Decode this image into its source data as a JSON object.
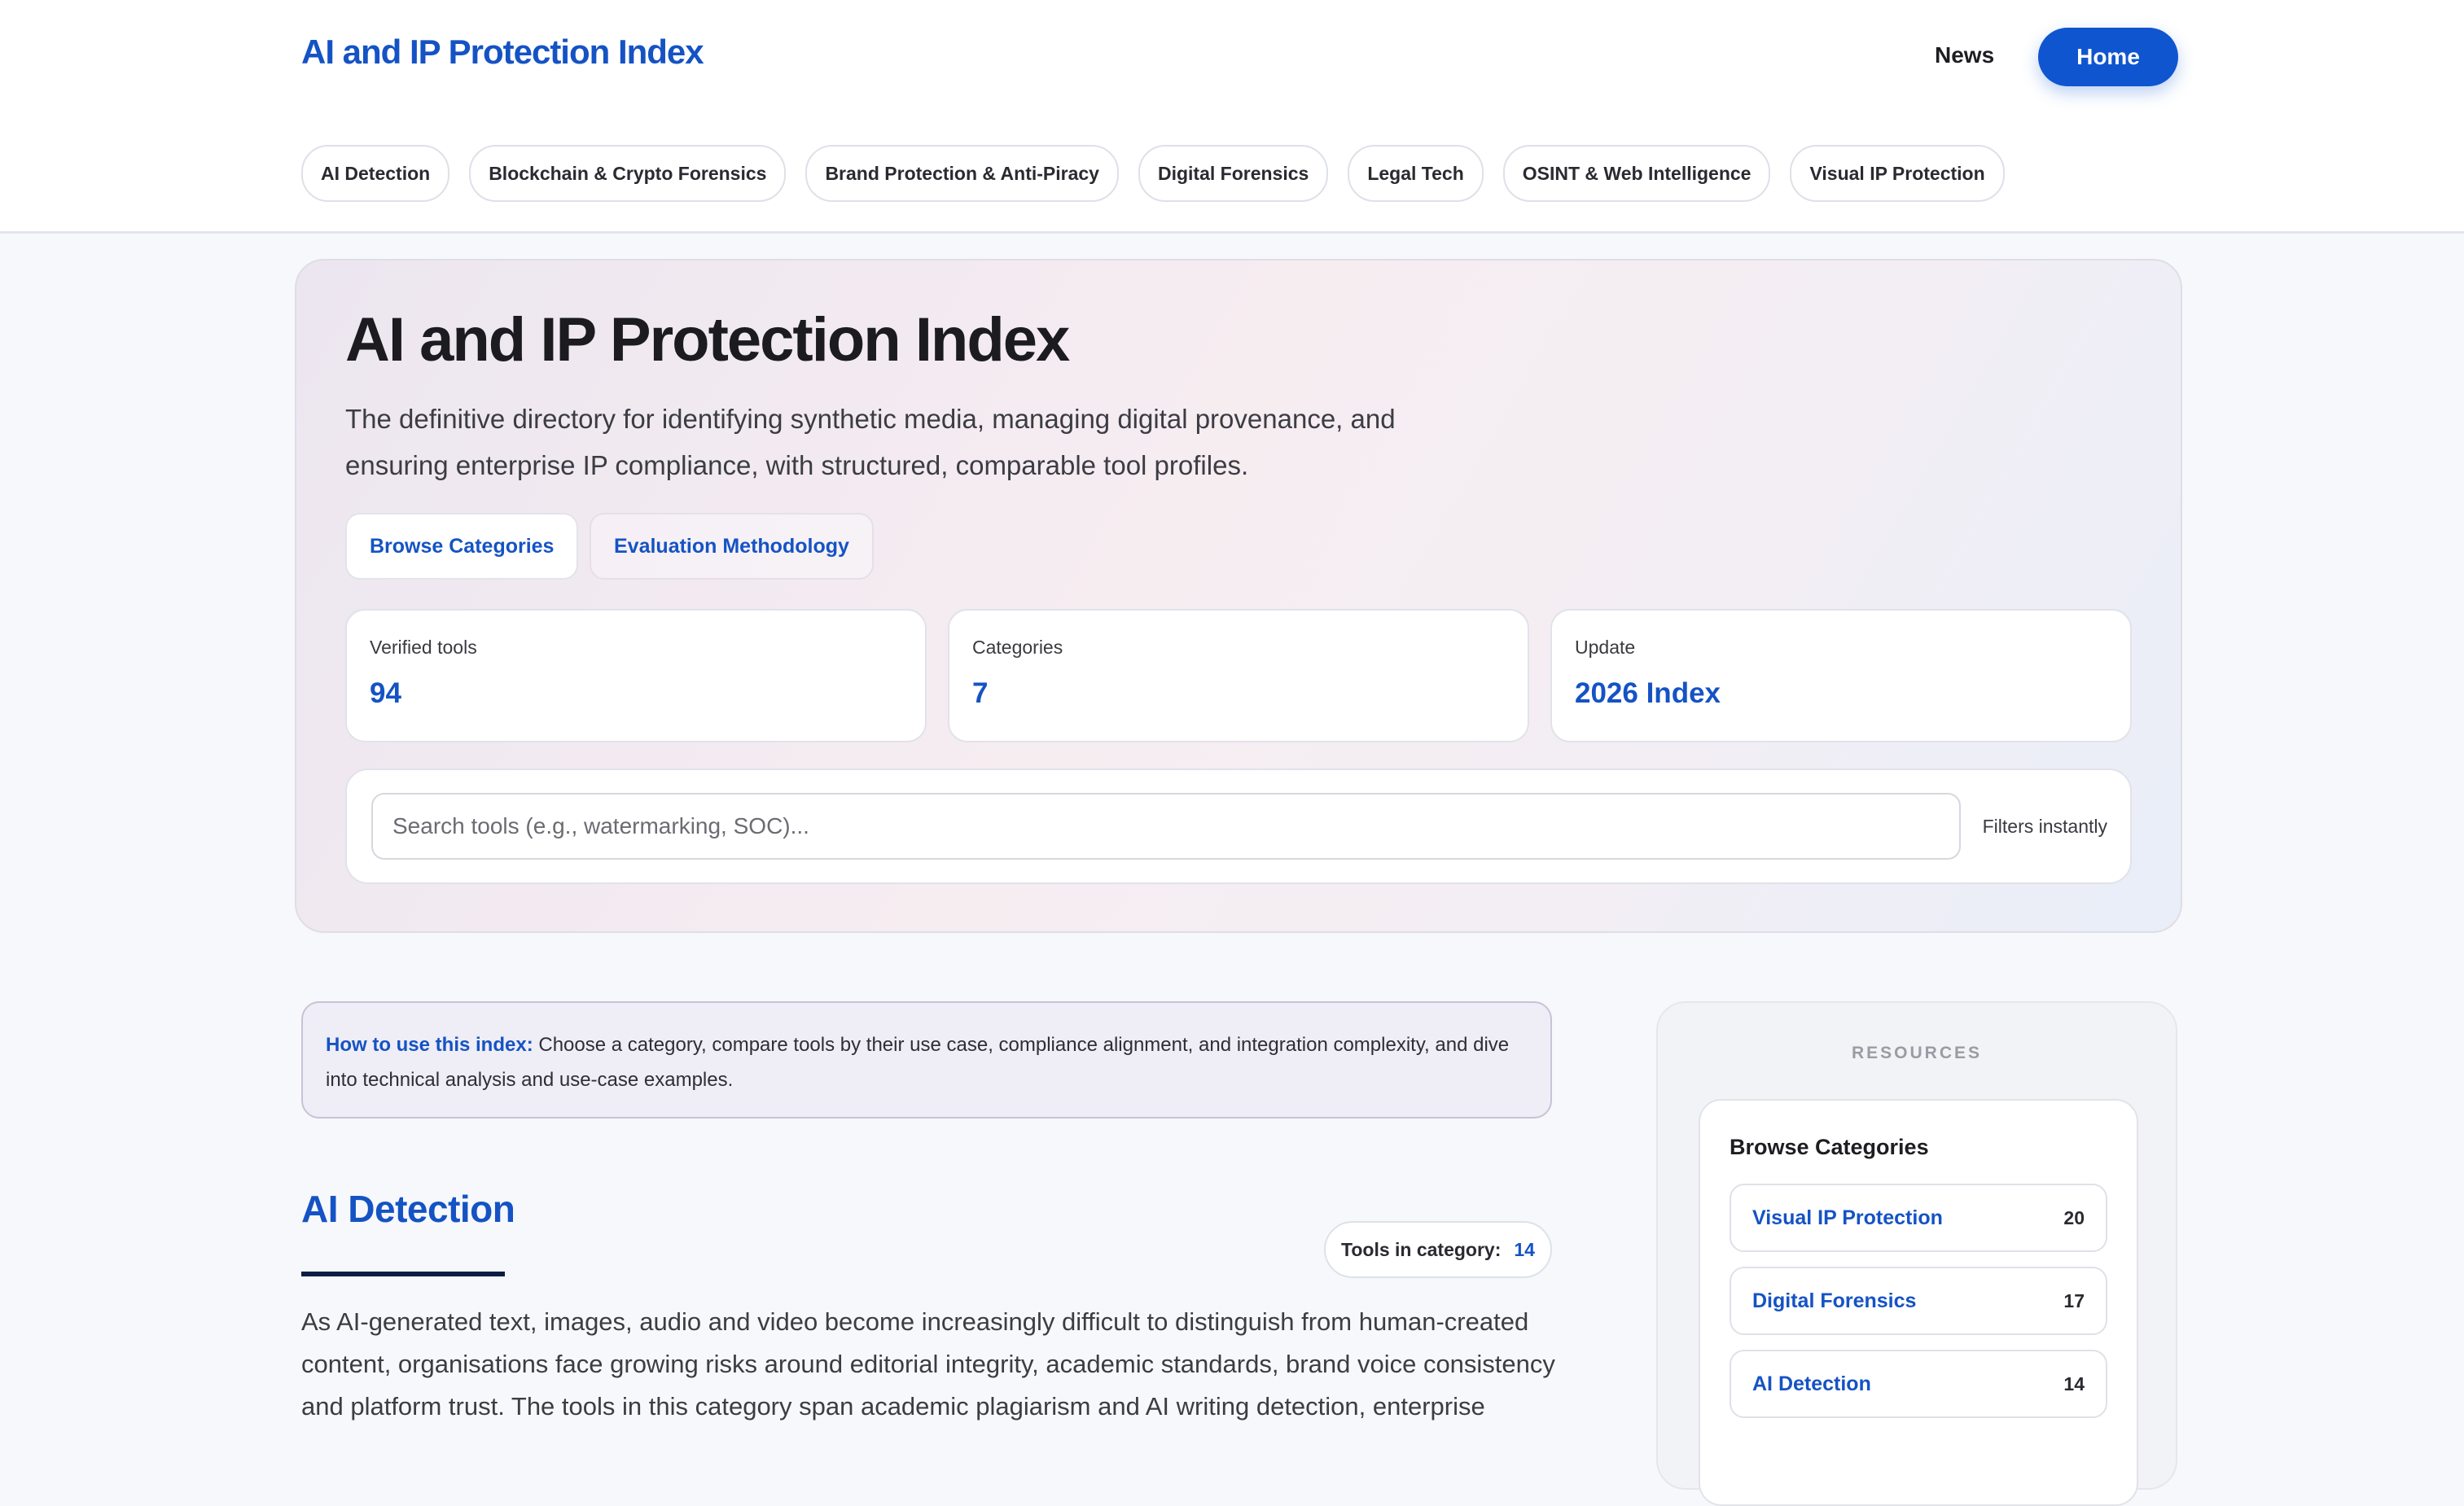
{
  "header": {
    "brand": "AI and IP Protection Index",
    "nav_news": "News",
    "nav_home": "Home",
    "category_chips": [
      "AI Detection",
      "Blockchain & Crypto Forensics",
      "Brand Protection & Anti-Piracy",
      "Digital Forensics",
      "Legal Tech",
      "OSINT & Web Intelligence",
      "Visual IP Protection"
    ]
  },
  "hero": {
    "title": "AI and IP Protection Index",
    "description": "The definitive directory for identifying synthetic media, managing digital provenance, and ensuring enterprise IP compliance, with structured, comparable tool profiles.",
    "browse_label": "Browse Categories",
    "methodology_label": "Evaluation Methodology",
    "stats": [
      {
        "label": "Verified tools",
        "value": "94"
      },
      {
        "label": "Categories",
        "value": "7"
      },
      {
        "label": "Update",
        "value": "2026 Index"
      }
    ],
    "search": {
      "placeholder": "Search tools (e.g., watermarking, SOC)...",
      "hint": "Filters instantly"
    }
  },
  "info": {
    "lead": "How to use this index:",
    "text": " Choose a category, compare tools by their use case, compliance alignment, and integration complexity, and dive into technical analysis and use-case examples."
  },
  "section": {
    "title": "AI Detection",
    "tools_label": "Tools in category:",
    "tools_count": "14",
    "body": "As AI-generated text, images, audio and video become increasingly difficult to distinguish from human-created content, organisations face growing risks around editorial integrity, academic standards, brand voice consistency and platform trust. The tools in this category span academic plagiarism and AI writing detection, enterprise"
  },
  "sidebar": {
    "heading": "RESOURCES",
    "card_title": "Browse Categories",
    "categories": [
      {
        "name": "Visual IP Protection",
        "count": "20"
      },
      {
        "name": "Digital Forensics",
        "count": "17"
      },
      {
        "name": "AI Detection",
        "count": "14"
      }
    ]
  },
  "colors": {
    "accent": "#1553c4",
    "home_button": "#0f55d0",
    "underline": "#0c1d44"
  }
}
